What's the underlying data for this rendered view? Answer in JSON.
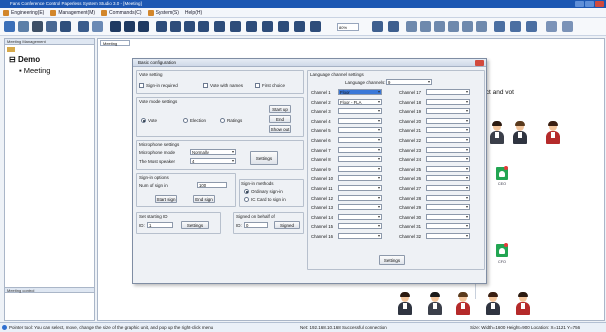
{
  "window": {
    "title": "Fans Conference Control Paperless System Studio 3.0 - [Meeting]"
  },
  "menu": [
    {
      "label": "Engineering(E)"
    },
    {
      "label": "Management(M)"
    },
    {
      "label": "Commands(C)"
    },
    {
      "label": "System(S)"
    },
    {
      "label": "Help(H)"
    }
  ],
  "toolbar": {
    "zoom_value": "80%"
  },
  "left_pane": {
    "header": "Meeting Management",
    "tree_root": "Demo",
    "tree_child": "Meeting",
    "bottom_header": "Meeting control"
  },
  "workspace": {
    "tab_label": "Meeting",
    "bg_text": "rect and vot"
  },
  "dialog": {
    "title": "Basic configuration",
    "vote_setting": {
      "title": "Vote setting",
      "sign_in_required": "Sign-in required",
      "vote_with_names": "Vote with names",
      "first_choice": "First choice"
    },
    "vote_mode": {
      "title": "Vote mode settings",
      "options": [
        "Vote",
        "Election",
        "Ratings"
      ],
      "start_up": "Start up",
      "end": "End",
      "show_out": "Show out"
    },
    "microphone": {
      "title": "Microphone settings",
      "mode_label": "Microphone mode",
      "mode_value": "Normally",
      "max_label": "The Most speaker",
      "max_value": "4",
      "settings_button": "Settings"
    },
    "sign_in_options": {
      "title": "Sign-in options",
      "num_label": "Num of sign in",
      "num_value": "100",
      "start_button": "Start sign",
      "end_button": "End sign"
    },
    "sign_in_methods": {
      "title": "Sign-in methods",
      "ordinary": "Ordinary sign-in",
      "ic_card": "IC Card to sign in"
    },
    "set_starting_id": {
      "title": "Set starting ID",
      "id_label": "ID:",
      "id_value": "1",
      "button": "Settings"
    },
    "signed_on_behalf": {
      "title": "Signed on behalf of",
      "id_label": "ID:",
      "id_value": "0",
      "button": "Signed"
    },
    "language": {
      "title": "Language channel settings",
      "channels_label": "Language channels:",
      "channels_value": "9",
      "left": [
        {
          "label": "Channel 1",
          "value": "Floor"
        },
        {
          "label": "Channel 2",
          "value": "Floor - FLA"
        },
        {
          "label": "Channel 3",
          "value": ""
        },
        {
          "label": "Channel 4",
          "value": ""
        },
        {
          "label": "Channel 5",
          "value": ""
        },
        {
          "label": "Channel 6",
          "value": ""
        },
        {
          "label": "Channel 7",
          "value": ""
        },
        {
          "label": "Channel 8",
          "value": ""
        },
        {
          "label": "Channel 9",
          "value": ""
        },
        {
          "label": "Channel 10",
          "value": ""
        },
        {
          "label": "Channel 11",
          "value": ""
        },
        {
          "label": "Channel 12",
          "value": ""
        },
        {
          "label": "Channel 13",
          "value": ""
        },
        {
          "label": "Channel 14",
          "value": ""
        },
        {
          "label": "Channel 15",
          "value": ""
        },
        {
          "label": "Channel 16",
          "value": ""
        }
      ],
      "right": [
        {
          "label": "Channel 17"
        },
        {
          "label": "Channel 18"
        },
        {
          "label": "Channel 19"
        },
        {
          "label": "Channel 20"
        },
        {
          "label": "Channel 21"
        },
        {
          "label": "Channel 22"
        },
        {
          "label": "Channel 23"
        },
        {
          "label": "Channel 24"
        },
        {
          "label": "Channel 25"
        },
        {
          "label": "Channel 26"
        },
        {
          "label": "Channel 27"
        },
        {
          "label": "Channel 28"
        },
        {
          "label": "Channel 29"
        },
        {
          "label": "Channel 30"
        },
        {
          "label": "Channel 31"
        },
        {
          "label": "Channel 32"
        }
      ],
      "settings_button": "Settings"
    }
  },
  "people_roles": {
    "r1": "CTO",
    "r2": "CFO",
    "r3": "Vice",
    "r4": "CEO"
  },
  "status": {
    "left": "Pointer tool: You can select, move, change the size of the graphic unit, and pop up the right-click menu",
    "mid": "Net: 192.168.10.168 Successful connection",
    "right": "Size: Width=1600 Height=900 Location: X=1121 Y=756"
  }
}
